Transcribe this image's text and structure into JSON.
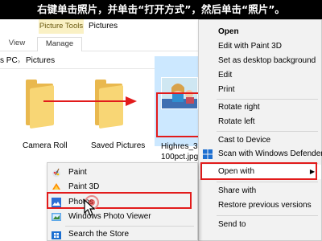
{
  "banner": {
    "text": "右键单击照片，并单击“打开方式”，然后单击“照片”。"
  },
  "explorer": {
    "ribbon": {
      "contextual_tab": "Picture Tools",
      "window_title": "Pictures",
      "tab_view": "View",
      "tab_manage": "Manage"
    },
    "address": {
      "pc": "s PC",
      "separator": "›",
      "current": "Pictures"
    },
    "items": [
      {
        "label": "Camera Roll"
      },
      {
        "label": "Saved Pictures"
      },
      {
        "label_line1": "Highres_30",
        "label_line2": "100pct.jpg"
      }
    ]
  },
  "context_menu": {
    "items": [
      {
        "label": "Open",
        "bold": true
      },
      {
        "label": "Edit with Paint 3D"
      },
      {
        "label": "Set as desktop background"
      },
      {
        "label": "Edit"
      },
      {
        "label": "Print"
      },
      {
        "label": "Rotate right"
      },
      {
        "label": "Rotate left"
      },
      {
        "label": "Cast to Device"
      },
      {
        "label": "Scan with Windows Defender"
      },
      {
        "label": "Open with"
      },
      {
        "label": "Share with"
      },
      {
        "label": "Restore previous versions"
      },
      {
        "label": "Send to"
      }
    ]
  },
  "open_with_menu": {
    "items": [
      {
        "label": "Paint",
        "icon": "paint-icon"
      },
      {
        "label": "Paint 3D",
        "icon": "paint-3d-icon"
      },
      {
        "label": "Photos",
        "icon": "photos-icon"
      },
      {
        "label": "Windows Photo Viewer",
        "icon": "photo-viewer-icon"
      },
      {
        "label": "Search the Store",
        "icon": "store-icon"
      }
    ]
  },
  "colors": {
    "highlight_box": "#e21b1b",
    "selection": "#cce8ff",
    "folder": "#f8d675",
    "menu_bg": "#f2f2f2"
  }
}
